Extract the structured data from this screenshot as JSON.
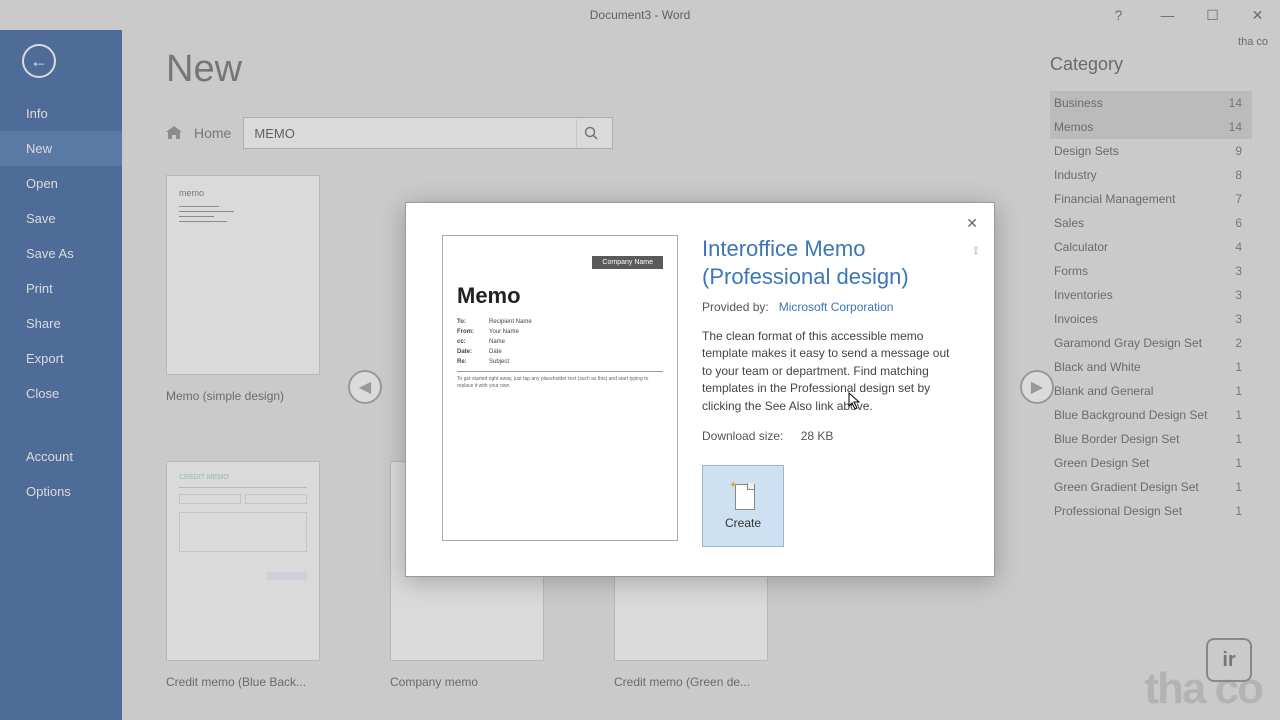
{
  "window": {
    "title": "Document3 - Word",
    "user": "tha co"
  },
  "sidebar": {
    "items": [
      {
        "label": "Info"
      },
      {
        "label": "New"
      },
      {
        "label": "Open"
      },
      {
        "label": "Save"
      },
      {
        "label": "Save As"
      },
      {
        "label": "Print"
      },
      {
        "label": "Share"
      },
      {
        "label": "Export"
      },
      {
        "label": "Close"
      }
    ],
    "footer": [
      {
        "label": "Account"
      },
      {
        "label": "Options"
      }
    ]
  },
  "page": {
    "title": "New",
    "breadcrumb": "Home",
    "search": "MEMO"
  },
  "templates": [
    {
      "label": "Memo (simple design)"
    },
    {
      "label": "Credit memo (Blue Back..."
    },
    {
      "label": "Company memo"
    },
    {
      "label": "Credit memo (Green de..."
    }
  ],
  "categories": {
    "heading": "Category",
    "items": [
      {
        "name": "Business",
        "count": "14",
        "selected": true
      },
      {
        "name": "Memos",
        "count": "14",
        "selected": true
      },
      {
        "name": "Design Sets",
        "count": "9"
      },
      {
        "name": "Industry",
        "count": "8"
      },
      {
        "name": "Financial Management",
        "count": "7"
      },
      {
        "name": "Sales",
        "count": "6"
      },
      {
        "name": "Calculator",
        "count": "4"
      },
      {
        "name": "Forms",
        "count": "3"
      },
      {
        "name": "Inventories",
        "count": "3"
      },
      {
        "name": "Invoices",
        "count": "3"
      },
      {
        "name": "Garamond Gray Design Set",
        "count": "2"
      },
      {
        "name": "Black and White",
        "count": "1"
      },
      {
        "name": "Blank and General",
        "count": "1"
      },
      {
        "name": "Blue Background Design Set",
        "count": "1"
      },
      {
        "name": "Blue Border Design Set",
        "count": "1"
      },
      {
        "name": "Green Design Set",
        "count": "1"
      },
      {
        "name": "Green Gradient Design Set",
        "count": "1"
      },
      {
        "name": "Professional Design Set",
        "count": "1"
      }
    ]
  },
  "modal": {
    "title": "Interoffice Memo (Professional design)",
    "provided_label": "Provided by:",
    "provided_by": "Microsoft Corporation",
    "description": "The clean format of this accessible memo template makes it easy to send a message out to your team or department. Find matching templates in the Professional design set by clicking the See Also link above.",
    "size_label": "Download size:",
    "size": "28 KB",
    "create": "Create",
    "preview": {
      "company": "Company Name",
      "memo": "Memo",
      "to_label": "To:",
      "to": "Recipient Name",
      "from_label": "From:",
      "from": "Your Name",
      "cc_label": "cc:",
      "cc": "Name",
      "date_label": "Date:",
      "date": "Date",
      "re_label": "Re:",
      "re": "Subject",
      "body": "To get started right away, just tap any placeholder text (such as this) and start typing to replace it with your own."
    }
  },
  "watermark": "tha co",
  "recorder": "ir"
}
